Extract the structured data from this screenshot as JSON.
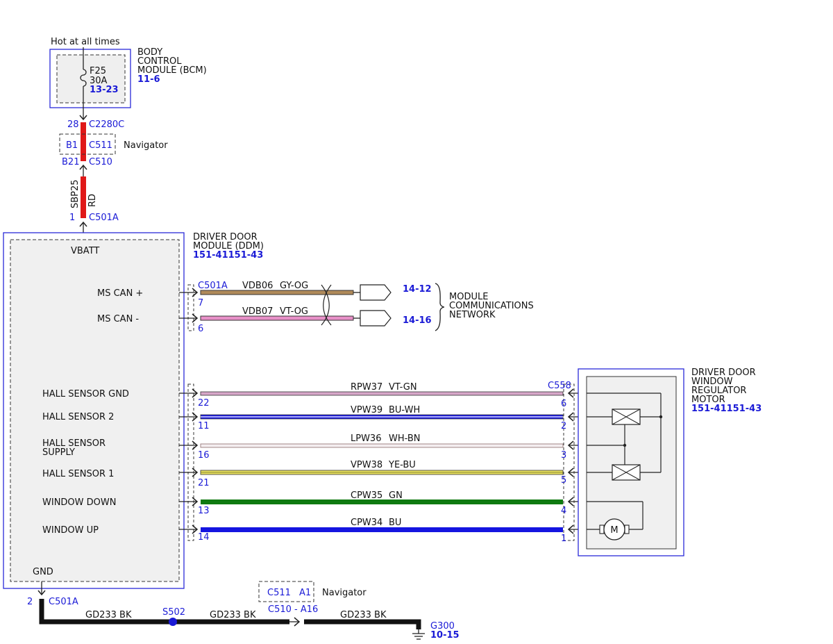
{
  "bcm": {
    "hot_label": "Hot at all times",
    "fuse_name": "F25",
    "fuse_rating": "30A",
    "fuse_ref": "13-23",
    "title_l1": "BODY",
    "title_l2": "CONTROL",
    "title_l3": "MODULE (BCM)",
    "ref": "11-6"
  },
  "feed": {
    "c2280c_pin": "28",
    "c2280c": "C2280C",
    "c511_pin": "B1",
    "c511": "C511",
    "navigator": "Navigator",
    "c510_pin": "B21",
    "c510": "C510",
    "circuit": "SBP25",
    "color": "RD",
    "c501a_pin": "1",
    "c501a": "C501A"
  },
  "ddm": {
    "title_l1": "DRIVER DOOR",
    "title_l2": "MODULE (DDM)",
    "ref": "151-41151-43",
    "vbatt": "VBATT",
    "gnd": "GND",
    "ms_can_plus": "MS CAN +",
    "ms_can_minus": "MS CAN -",
    "hall_sensor_gnd": "HALL SENSOR GND",
    "hall_sensor_2": "HALL SENSOR 2",
    "hall_sensor_supply_l1": "HALL SENSOR",
    "hall_sensor_supply_l2": "SUPPLY",
    "hall_sensor_1": "HALL SENSOR 1",
    "window_down": "WINDOW DOWN",
    "window_up": "WINDOW UP"
  },
  "can": {
    "connector": "C501A",
    "w1_pin": "7",
    "w1_circuit": "VDB06",
    "w1_color": "GY-OG",
    "w1_ref": "14-12",
    "w2_pin": "6",
    "w2_circuit": "VDB07",
    "w2_color": "VT-OG",
    "w2_ref": "14-16",
    "net_l1": "MODULE",
    "net_l2": "COMMUNICATIONS",
    "net_l3": "NETWORK"
  },
  "motor": {
    "connector": "C558",
    "title_l1": "DRIVER DOOR",
    "title_l2": "WINDOW",
    "title_l3": "REGULATOR",
    "title_l4": "MOTOR",
    "ref": "151-41151-43",
    "m": "M"
  },
  "wires": [
    {
      "ddm_pin": "22",
      "circuit": "RPW37",
      "color": "VT-GN",
      "motor_pin": "6"
    },
    {
      "ddm_pin": "11",
      "circuit": "VPW39",
      "color": "BU-WH",
      "motor_pin": "2"
    },
    {
      "ddm_pin": "16",
      "circuit": "LPW36",
      "color": "WH-BN",
      "motor_pin": "3"
    },
    {
      "ddm_pin": "21",
      "circuit": "VPW38",
      "color": "YE-BU",
      "motor_pin": "5"
    },
    {
      "ddm_pin": "13",
      "circuit": "CPW35",
      "color": "GN",
      "motor_pin": "4"
    },
    {
      "ddm_pin": "14",
      "circuit": "CPW34",
      "color": "BU",
      "motor_pin": "1"
    }
  ],
  "ground": {
    "c501a_pin": "2",
    "c501a": "C501A",
    "seg1": "GD233  BK",
    "splice": "S502",
    "seg2": "GD233  BK",
    "c511": "C511",
    "c511_pin": "A1",
    "navigator": "Navigator",
    "c510": "C510 - A16",
    "seg3": "GD233  BK",
    "g300": "G300",
    "ref": "10-15"
  },
  "colors": {
    "accent_blue": "#1a1ad6",
    "red": "#e01818",
    "green": "#0f7a10",
    "blue": "#1515e0"
  }
}
